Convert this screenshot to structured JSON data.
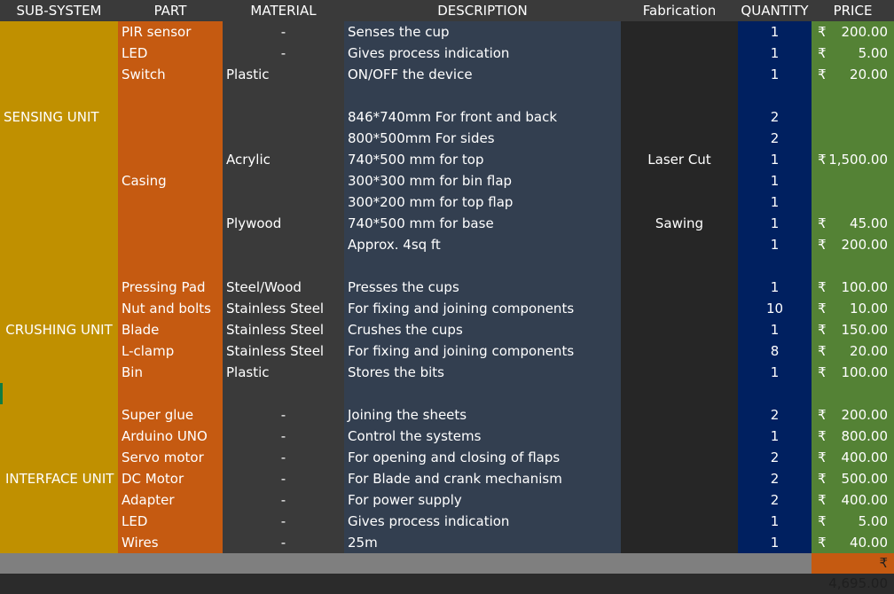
{
  "headers": {
    "subsystem": "SUB-SYSTEM",
    "part": "PART",
    "material": "MATERIAL",
    "description": "DESCRIPTION",
    "fabrication": "Fabrication",
    "quantity": "QUANTITY",
    "price": "PRICE"
  },
  "currency": "₹",
  "subsystems": {
    "sensing": "SENSING UNIT",
    "crushing": "CRUSHING UNIT",
    "interface": "INTERFACE UNIT"
  },
  "merged": {
    "casing_part": "Casing",
    "acrylic": "Acrylic",
    "laser_cut": "Laser Cut",
    "acrylic_price": "1,500.00"
  },
  "rows": [
    {
      "part": "PIR sensor",
      "material": "-",
      "description": "Senses the cup",
      "fabrication": "",
      "quantity": "1",
      "price": "200.00"
    },
    {
      "part": "LED",
      "material": "-",
      "description": "Gives process indication",
      "fabrication": "",
      "quantity": "1",
      "price": "5.00"
    },
    {
      "part": "Switch",
      "material": "Plastic",
      "description": "ON/OFF the device",
      "fabrication": "",
      "quantity": "1",
      "price": "20.00"
    },
    {
      "part": "",
      "material": "",
      "description": "",
      "fabrication": "",
      "quantity": "",
      "price": ""
    },
    {
      "part": "",
      "material": "",
      "description": "846*740mm For front and back",
      "fabrication": "",
      "quantity": "2",
      "price": ""
    },
    {
      "part": "",
      "material": "",
      "description": "800*500mm For sides",
      "fabrication": "",
      "quantity": "2",
      "price": ""
    },
    {
      "part": "",
      "material": "",
      "description": "740*500 mm for top",
      "fabrication": "",
      "quantity": "1",
      "price": ""
    },
    {
      "part": "",
      "material": "",
      "description": "300*300 mm for bin flap",
      "fabrication": "",
      "quantity": "1",
      "price": ""
    },
    {
      "part": "",
      "material": "",
      "description": "300*200 mm for top flap",
      "fabrication": "",
      "quantity": "1",
      "price": ""
    },
    {
      "part": "",
      "material": "Plywood",
      "description": "740*500 mm for base",
      "fabrication": "Sawing",
      "quantity": "1",
      "price": "45.00"
    },
    {
      "part": "",
      "material": "",
      "description": "Approx. 4sq ft",
      "fabrication": "",
      "quantity": "1",
      "price": "200.00"
    },
    {
      "part": "",
      "material": "",
      "description": "",
      "fabrication": "",
      "quantity": "",
      "price": ""
    },
    {
      "part": "Pressing Pad",
      "material": "Steel/Wood",
      "description": "Presses the cups",
      "fabrication": "",
      "quantity": "1",
      "price": "100.00"
    },
    {
      "part": "Nut and bolts",
      "material": "Stainless Steel",
      "description": "For fixing and joining components",
      "fabrication": "",
      "quantity": "10",
      "price": "10.00"
    },
    {
      "part": "Blade",
      "material": "Stainless Steel",
      "description": "Crushes the cups",
      "fabrication": "",
      "quantity": "1",
      "price": "150.00"
    },
    {
      "part": "L-clamp",
      "material": "Stainless Steel",
      "description": "For fixing and joining components",
      "fabrication": "",
      "quantity": "8",
      "price": "20.00"
    },
    {
      "part": "Bin",
      "material": "Plastic",
      "description": "Stores the bits",
      "fabrication": "",
      "quantity": "1",
      "price": "100.00"
    },
    {
      "part": "",
      "material": "",
      "description": "",
      "fabrication": "",
      "quantity": "",
      "price": ""
    },
    {
      "part": "Super glue",
      "material": "-",
      "description": "Joining the sheets",
      "fabrication": "",
      "quantity": "2",
      "price": "200.00"
    },
    {
      "part": "Arduino UNO",
      "material": "-",
      "description": "Control the systems",
      "fabrication": "",
      "quantity": "1",
      "price": "800.00"
    },
    {
      "part": "Servo motor",
      "material": "-",
      "description": "For opening and closing of flaps",
      "fabrication": "",
      "quantity": "2",
      "price": "400.00"
    },
    {
      "part": "DC Motor",
      "material": "-",
      "description": "For Blade and crank mechanism",
      "fabrication": "",
      "quantity": "2",
      "price": "500.00"
    },
    {
      "part": " Adapter",
      "material": "-",
      "description": "For power supply",
      "fabrication": "",
      "quantity": "2",
      "price": "400.00"
    },
    {
      "part": "LED",
      "material": "-",
      "description": "Gives process indication",
      "fabrication": "",
      "quantity": "1",
      "price": "5.00"
    },
    {
      "part": "Wires",
      "material": "-",
      "description": "25m",
      "fabrication": "",
      "quantity": "1",
      "price": "40.00"
    }
  ],
  "total": "₹ 4,695.00"
}
